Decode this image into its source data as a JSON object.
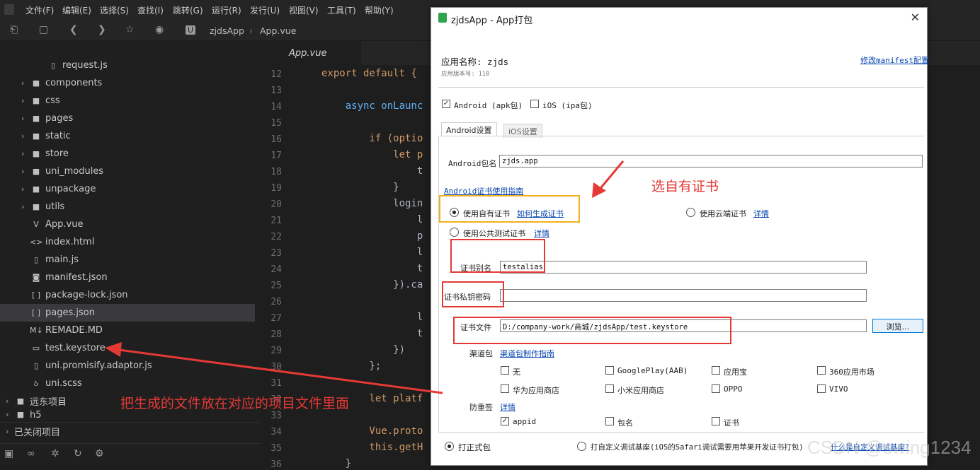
{
  "menubar": {
    "items": [
      "文件(F)",
      "编辑(E)",
      "选择(S)",
      "查找(I)",
      "跳转(G)",
      "运行(R)",
      "发行(U)",
      "视图(V)",
      "工具(T)",
      "帮助(Y)"
    ]
  },
  "breadcrumb": {
    "project": "zjdsApp",
    "file": "App.vue"
  },
  "editor": {
    "tab": "App.vue",
    "lines": [
      {
        "n": "12",
        "t": "export default {"
      },
      {
        "n": "13",
        "t": ""
      },
      {
        "n": "14",
        "t": "    async onLaunc"
      },
      {
        "n": "15",
        "t": ""
      },
      {
        "n": "16",
        "t": "        if (optio"
      },
      {
        "n": "17",
        "t": "            let p"
      },
      {
        "n": "18",
        "t": "                t"
      },
      {
        "n": "19",
        "t": "            }"
      },
      {
        "n": "20",
        "t": "            login"
      },
      {
        "n": "21",
        "t": "                l"
      },
      {
        "n": "22",
        "t": "                p"
      },
      {
        "n": "23",
        "t": "                l"
      },
      {
        "n": "24",
        "t": "                t"
      },
      {
        "n": "25",
        "t": "            }).ca"
      },
      {
        "n": "26",
        "t": ""
      },
      {
        "n": "27",
        "t": "                l"
      },
      {
        "n": "28",
        "t": "                t"
      },
      {
        "n": "29",
        "t": "            })"
      },
      {
        "n": "30",
        "t": "        };"
      },
      {
        "n": "31",
        "t": ""
      },
      {
        "n": "32",
        "t": "        let platf"
      },
      {
        "n": "33",
        "t": ""
      },
      {
        "n": "34",
        "t": "        Vue.proto"
      },
      {
        "n": "35",
        "t": "        this.getH"
      },
      {
        "n": "36",
        "t": "    }"
      }
    ]
  },
  "sidebar": {
    "items": [
      {
        "label": "request.js",
        "icon": "file-icon"
      },
      {
        "label": "components",
        "icon": "folder-icon"
      },
      {
        "label": "css",
        "icon": "folder-icon"
      },
      {
        "label": "pages",
        "icon": "folder-icon"
      },
      {
        "label": "static",
        "icon": "folder-icon"
      },
      {
        "label": "store",
        "icon": "folder-icon"
      },
      {
        "label": "uni_modules",
        "icon": "folder-icon"
      },
      {
        "label": "unpackage",
        "icon": "folder-icon"
      },
      {
        "label": "utils",
        "icon": "folder-icon"
      },
      {
        "label": "App.vue",
        "icon": "vue-file-icon"
      },
      {
        "label": "index.html",
        "icon": "html-file-icon"
      },
      {
        "label": "main.js",
        "icon": "file-icon"
      },
      {
        "label": "manifest.json",
        "icon": "json-file-icon"
      },
      {
        "label": "package-lock.json",
        "icon": "json-file-icon"
      },
      {
        "label": "pages.json",
        "icon": "json-file-icon"
      },
      {
        "label": "REMADE.MD",
        "icon": "markdown-file-icon"
      },
      {
        "label": "test.keystore",
        "icon": "file-icon"
      },
      {
        "label": "uni.promisify.adaptor.js",
        "icon": "file-icon"
      },
      {
        "label": "uni.scss",
        "icon": "file-icon"
      },
      {
        "label": "远东项目",
        "icon": "project-icon"
      },
      {
        "label": "h5",
        "icon": "project-icon"
      },
      {
        "label": "已关闭项目",
        "icon": "folder-icon"
      }
    ]
  },
  "dialog": {
    "title": "zjdsApp - App打包",
    "app_name": "应用名称: zjds",
    "app_version": "应用版本号: 110",
    "modify_manifest": "修改manifest配置",
    "android_label": "Android (apk包)",
    "ios_label": "iOS (ipa包)",
    "tab_android": "Android设置",
    "tab_ios": "iOS设置",
    "pkg_label": "Android包名",
    "pkg_value": "zjds.app",
    "cert_guide": "Android证书使用指南",
    "use_own_cert": "使用自有证书",
    "how_to_gen": "如何生成证书",
    "use_cloud_cert": "使用云端证书",
    "detail": "详情",
    "use_public_cert": "使用公共测试证书",
    "alias_label": "证书别名",
    "alias_value": "testalias",
    "pwd_label": "证书私钥密码",
    "pwd_value": "",
    "file_label": "证书文件",
    "file_value": "D:/company-work/商城/zjdsApp/test.keystore",
    "browse": "浏览...",
    "channel_label": "渠道包",
    "channel_guide": "渠道包制作指南",
    "channels": [
      {
        "label": "无",
        "checked": false
      },
      {
        "label": "GooglePlay(AAB)",
        "checked": false
      },
      {
        "label": "应用宝",
        "checked": false
      },
      {
        "label": "360应用市场",
        "checked": false
      },
      {
        "label": "华为应用商店",
        "checked": false
      },
      {
        "label": "小米应用商店",
        "checked": false
      },
      {
        "label": "OPPO",
        "checked": false
      },
      {
        "label": "VIVO",
        "checked": false
      }
    ],
    "anti_label": "防重签",
    "anti_detail": "详情",
    "anti_items": [
      {
        "label": "appid",
        "checked": true
      },
      {
        "label": "包名",
        "checked": false
      },
      {
        "label": "证书",
        "checked": false
      }
    ],
    "formal_pkg": "打正式包",
    "custom_base": "打自定义调试基座(iOS的Safari调试需要用苹果开发证书打包)",
    "what_is_base": "什么是自定义调试基座?"
  },
  "annotations": {
    "select_own": "选自有证书",
    "put_file": "把生成的文件放在对应的项目文件里面"
  },
  "watermark": "CSDN @swing1234",
  "colors": {
    "annotation": "#e53935",
    "highlight": "#f2b01e",
    "link": "#0645ad"
  }
}
